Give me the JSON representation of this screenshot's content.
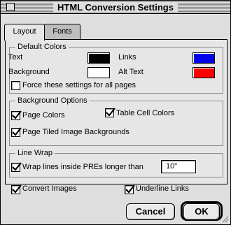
{
  "window": {
    "title": "HTML Conversion Settings"
  },
  "tabs": [
    {
      "label": "Layout",
      "active": true
    },
    {
      "label": "Fonts",
      "active": false
    }
  ],
  "default_colors": {
    "title": "Default Colors",
    "text_label": "Text",
    "text_color": "#000000",
    "links_label": "Links",
    "links_color": "#0000ee",
    "background_label": "Background",
    "background_color": "#ffffff",
    "alt_text_label": "Alt Text",
    "alt_text_color": "#ff0000",
    "force_label": "Force these settings for all pages",
    "force_checked": false
  },
  "background_options": {
    "title": "Background Options",
    "page_colors_label": "Page Colors",
    "page_colors_checked": true,
    "table_cell_label": "Table Cell Colors",
    "table_cell_checked": true,
    "tiled_label": "Page Tiled Image Backgrounds",
    "tiled_checked": true
  },
  "line_wrap": {
    "title": "Line Wrap",
    "wrap_label": "Wrap lines inside PREs longer than",
    "wrap_checked": true,
    "wrap_value": "10\""
  },
  "misc": {
    "convert_images_label": "Convert Images",
    "convert_images_checked": true,
    "underline_links_label": "Underline Links",
    "underline_links_checked": true
  },
  "buttons": {
    "cancel_label": "Cancel",
    "ok_label": "OK"
  }
}
